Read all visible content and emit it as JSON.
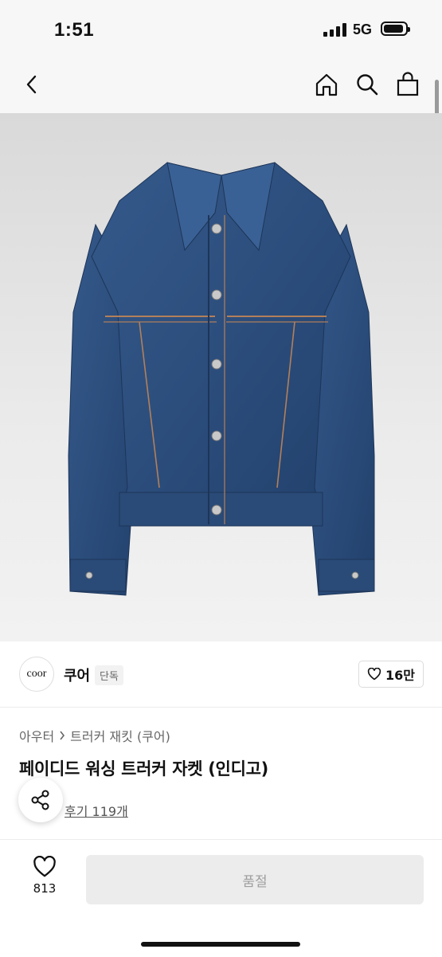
{
  "status_bar": {
    "time": "1:51",
    "network": "5G"
  },
  "brand": {
    "logo_text": "coor",
    "name": "쿠어",
    "badge": "단독",
    "likes": "16만"
  },
  "product": {
    "breadcrumb": [
      "아우터",
      "트러커 재킷 (쿠어)"
    ],
    "title": "페이디드 워싱 트러커 자켓 (인디고)",
    "review_link": "후기 119개"
  },
  "bottom_bar": {
    "wish_count": "813",
    "soldout_label": "품절"
  },
  "colors": {
    "denim": "#2c4e7d",
    "denim_dark": "#1d3558",
    "seam": "#b3805a",
    "button_disabled": "#ececec"
  },
  "icons": [
    "back-chevron-icon",
    "home-icon",
    "search-icon",
    "bag-icon",
    "heart-icon",
    "share-icon",
    "chevron-right-icon"
  ]
}
